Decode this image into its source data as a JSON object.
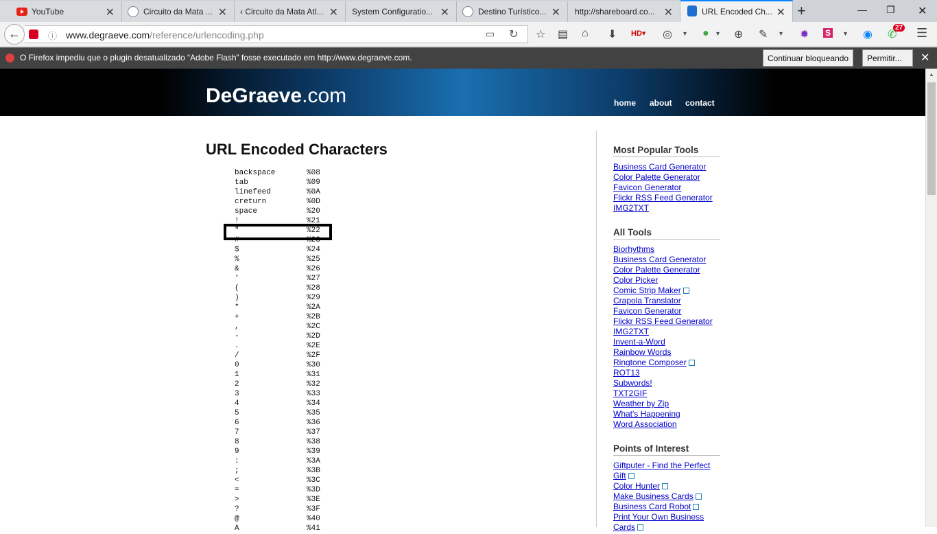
{
  "tabs": [
    {
      "label": "YouTube"
    },
    {
      "label": "Circuito da Mata ..."
    },
    {
      "label": "‹ Circuito da Mata Atl..."
    },
    {
      "label": "System Configuratio..."
    },
    {
      "label": "Destino Turístico..."
    },
    {
      "label": "http://shareboard.co..."
    },
    {
      "label": "URL Encoded Ch..."
    }
  ],
  "urlbar": {
    "domain": "www.degraeve.com",
    "path": "/reference/urlencoding.php"
  },
  "toolbar": {
    "notification_count": "27"
  },
  "notification": {
    "text": "O Firefox impediu que o plugin desatualizado “Adobe Flash” fosse executado em http://www.degraeve.com.",
    "keep_blocking": "Continuar bloqueando",
    "allow": "Permitir..."
  },
  "site": {
    "logo_main": "DeGraeve",
    "logo_tld": ".com",
    "nav": {
      "home": "home",
      "about": "about",
      "contact": "contact"
    }
  },
  "page": {
    "title": "URL Encoded Characters"
  },
  "codes": [
    {
      "name": "backspace",
      "code": "%08"
    },
    {
      "name": "tab",
      "code": "%09"
    },
    {
      "name": "linefeed",
      "code": "%0A"
    },
    {
      "name": "creturn",
      "code": "%0D"
    },
    {
      "name": "space",
      "code": "%20"
    },
    {
      "name": "!",
      "code": "%21"
    },
    {
      "name": "\"",
      "code": "%22"
    },
    {
      "name": "#",
      "code": "%23"
    },
    {
      "name": "$",
      "code": "%24"
    },
    {
      "name": "%",
      "code": "%25"
    },
    {
      "name": "&",
      "code": "%26"
    },
    {
      "name": "'",
      "code": "%27"
    },
    {
      "name": "(",
      "code": "%28"
    },
    {
      "name": ")",
      "code": "%29"
    },
    {
      "name": "*",
      "code": "%2A"
    },
    {
      "name": "+",
      "code": "%2B"
    },
    {
      "name": ",",
      "code": "%2C"
    },
    {
      "name": "-",
      "code": "%2D"
    },
    {
      "name": ".",
      "code": "%2E"
    },
    {
      "name": "/",
      "code": "%2F"
    },
    {
      "name": "0",
      "code": "%30"
    },
    {
      "name": "1",
      "code": "%31"
    },
    {
      "name": "2",
      "code": "%32"
    },
    {
      "name": "3",
      "code": "%33"
    },
    {
      "name": "4",
      "code": "%34"
    },
    {
      "name": "5",
      "code": "%35"
    },
    {
      "name": "6",
      "code": "%36"
    },
    {
      "name": "7",
      "code": "%37"
    },
    {
      "name": "8",
      "code": "%38"
    },
    {
      "name": "9",
      "code": "%39"
    },
    {
      "name": ":",
      "code": "%3A"
    },
    {
      "name": ";",
      "code": "%3B"
    },
    {
      "name": "<",
      "code": "%3C"
    },
    {
      "name": "=",
      "code": "%3D"
    },
    {
      "name": ">",
      "code": "%3E"
    },
    {
      "name": "?",
      "code": "%3F"
    },
    {
      "name": "@",
      "code": "%40"
    },
    {
      "name": "A",
      "code": "%41"
    }
  ],
  "sidebar": {
    "popular_title": "Most Popular Tools",
    "popular": [
      {
        "label": "Business Card Generator"
      },
      {
        "label": "Color Palette Generator"
      },
      {
        "label": "Favicon Generator"
      },
      {
        "label": "Flickr RSS Feed Generator"
      },
      {
        "label": "IMG2TXT"
      }
    ],
    "all_title": "All Tools",
    "all": [
      {
        "label": "Biorhythms"
      },
      {
        "label": "Business Card Generator"
      },
      {
        "label": "Color Palette Generator"
      },
      {
        "label": "Color Picker"
      },
      {
        "label": "Comic Strip Maker"
      },
      {
        "label": "Crapola Translator"
      },
      {
        "label": "Favicon Generator"
      },
      {
        "label": "Flickr RSS Feed Generator"
      },
      {
        "label": "IMG2TXT"
      },
      {
        "label": "Invent-a-Word"
      },
      {
        "label": "Rainbow Words"
      },
      {
        "label": "Ringtone Composer"
      },
      {
        "label": "ROT13"
      },
      {
        "label": "Subwords!"
      },
      {
        "label": "TXT2GIF"
      },
      {
        "label": "Weather by Zip"
      },
      {
        "label": "What's Happening"
      },
      {
        "label": "Word Association"
      }
    ],
    "poi_title": "Points of Interest",
    "poi": [
      {
        "label": "Giftputer - Find the Perfect"
      },
      {
        "label": "Gift"
      },
      {
        "label": "Color Hunter"
      },
      {
        "label": "Make Business Cards"
      },
      {
        "label": "Business Card Robot"
      },
      {
        "label": "Print Your Own Business"
      },
      {
        "label": "Cards"
      }
    ]
  }
}
